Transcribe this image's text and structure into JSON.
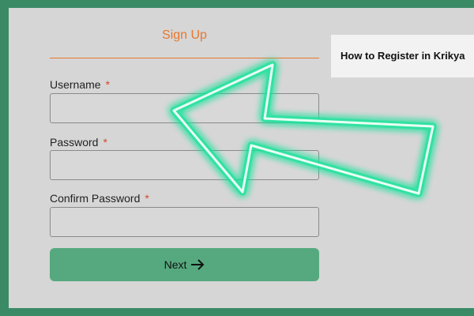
{
  "signup": {
    "tab_label": "Sign Up",
    "fields": [
      {
        "label": "Username",
        "required_mark": "*",
        "value": ""
      },
      {
        "label": "Password",
        "required_mark": "*",
        "value": ""
      },
      {
        "label": "Confirm Password",
        "required_mark": "*",
        "value": ""
      }
    ],
    "next_label": "Next"
  },
  "side_panel": {
    "title": "How to Register in Krikya"
  },
  "colors": {
    "frame_border": "#3a8a66",
    "background": "#d6d6d6",
    "accent": "#e8772e",
    "required": "#d9472b",
    "button": "#56a97f",
    "arrow_glow": "#19e39a"
  },
  "icons": {
    "next": "arrow-right-icon",
    "overlay": "neon-pointer-arrow"
  }
}
